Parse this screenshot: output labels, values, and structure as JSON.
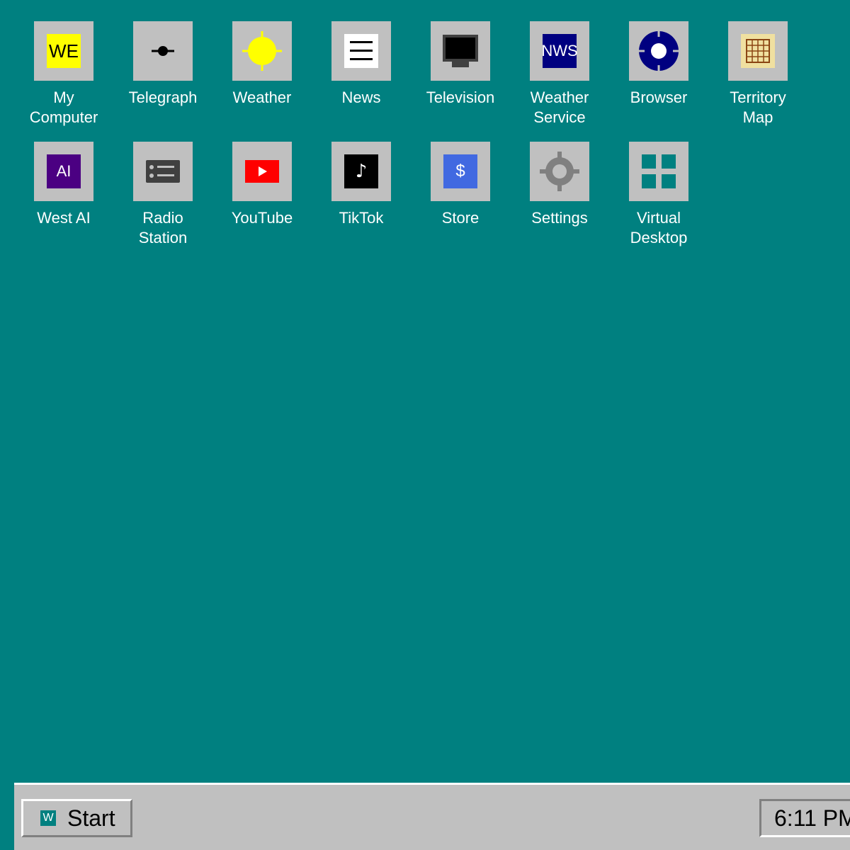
{
  "desktop": {
    "background": "#008080",
    "icons": [
      {
        "label_lines": [
          "My",
          "Computer"
        ],
        "glyph": "WE"
      },
      {
        "label_lines": [
          "Telegraph"
        ]
      },
      {
        "label_lines": [
          "Weather"
        ]
      },
      {
        "label_lines": [
          "News"
        ]
      },
      {
        "label_lines": [
          "Television"
        ]
      },
      {
        "label_lines": [
          "Weather",
          "Service"
        ],
        "glyph": "NWS"
      },
      {
        "label_lines": [
          "Browser"
        ]
      },
      {
        "label_lines": [
          "Territory",
          "Map"
        ]
      },
      {
        "label_lines": [
          "West AI"
        ],
        "glyph": "AI"
      },
      {
        "label_lines": [
          "Radio",
          "Station"
        ]
      },
      {
        "label_lines": [
          "YouTube"
        ]
      },
      {
        "label_lines": [
          "TikTok"
        ],
        "glyph": "♪"
      },
      {
        "label_lines": [
          "Store"
        ],
        "glyph": "$"
      },
      {
        "label_lines": [
          "Settings"
        ]
      },
      {
        "label_lines": [
          "Virtual",
          "Desktop"
        ]
      }
    ]
  },
  "taskbar": {
    "start_logo": "W",
    "start_label": "Start",
    "clock": "6:11 PM"
  }
}
